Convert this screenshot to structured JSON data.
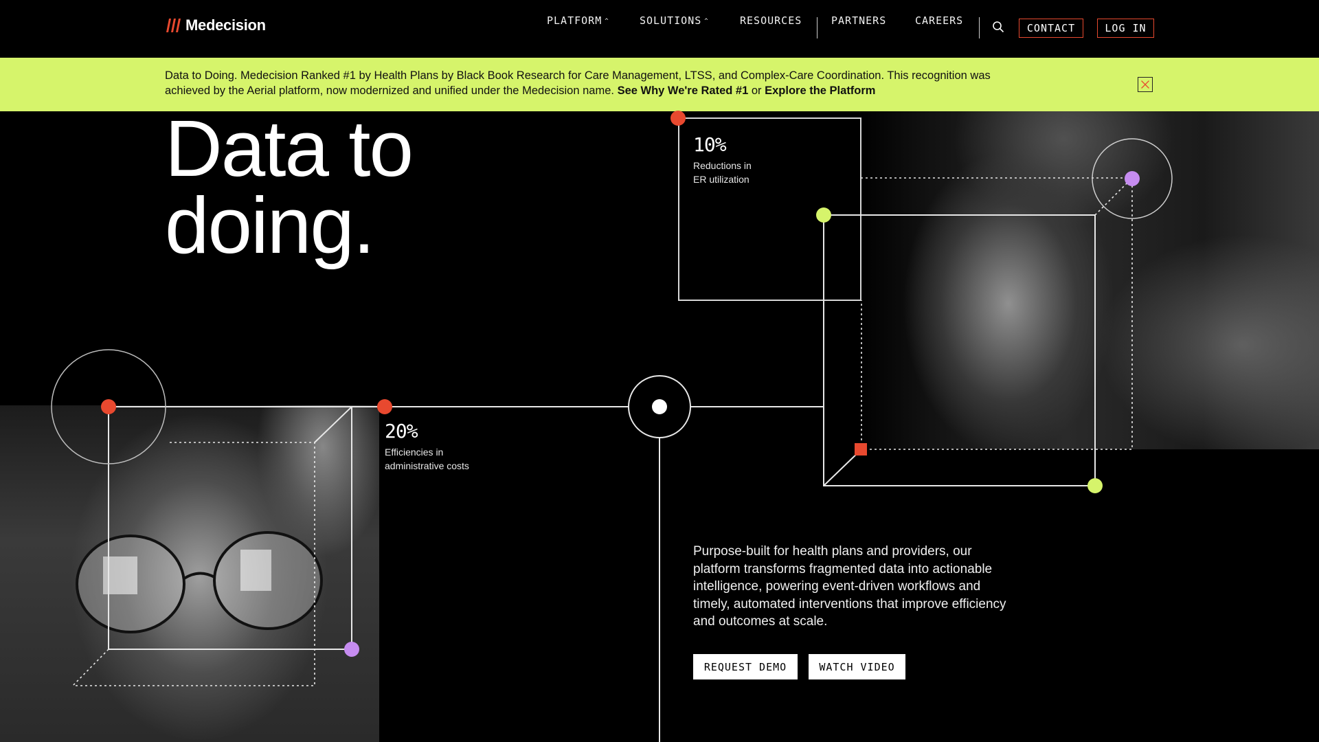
{
  "brand": {
    "name": "Medecision",
    "accent": "#e8492f",
    "lime": "#d6f46b",
    "lavender": "#c68cf0"
  },
  "nav": {
    "items": [
      {
        "label": "PLATFORM",
        "has_menu": true
      },
      {
        "label": "SOLUTIONS",
        "has_menu": true
      },
      {
        "label": "RESOURCES",
        "has_menu": false
      },
      {
        "label": "PARTNERS",
        "has_menu": false
      },
      {
        "label": "CAREERS",
        "has_menu": false
      }
    ],
    "search_icon": "search-icon",
    "contact_label": "CONTACT",
    "login_label": "LOG IN",
    "chevron": "^"
  },
  "banner": {
    "text": "Data to Doing. Medecision Ranked #1 by Health Plans by Black Book Research for Care Management, LTSS, and Complex-Care Coordination. This recognition was achieved by the Aerial platform, now modernized and unified under the Medecision name. ",
    "link1": "See Why We're Rated #1",
    "or": " or ",
    "link2": "Explore the Platform",
    "close_icon": "close-icon"
  },
  "hero": {
    "title_line1": "Data to",
    "title_line2": "doing.",
    "stat1": {
      "value": "10%",
      "label_line1": "Reductions in",
      "label_line2": "ER utilization"
    },
    "stat2": {
      "value": "20%",
      "label_line1": "Efficiencies in",
      "label_line2": "administrative costs"
    },
    "description": "Purpose-built for health plans and providers, our platform transforms fragmented data into actionable intelligence, powering event-driven workflows and timely, automated interventions that improve efficiency and outcomes at scale.",
    "request_demo_label": "REQUEST DEMO",
    "watch_video_label": "WATCH VIDEO"
  }
}
